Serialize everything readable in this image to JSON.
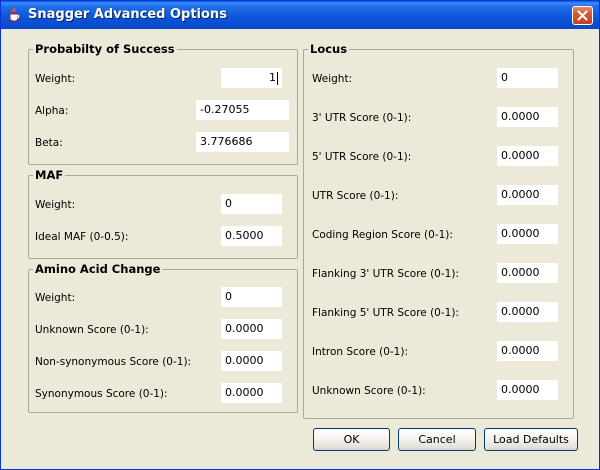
{
  "window": {
    "title": "Snagger Advanced Options"
  },
  "probability": {
    "legend": "Probabilty of Success",
    "weight_label": "Weight:",
    "weight_value": "1",
    "alpha_label": "Alpha:",
    "alpha_value": "-0.27055",
    "beta_label": "Beta:",
    "beta_value": "3.776686"
  },
  "maf": {
    "legend": "MAF",
    "weight_label": "Weight:",
    "weight_value": "0",
    "ideal_label": "Ideal MAF (0-0.5):",
    "ideal_value": "0.5000"
  },
  "amino": {
    "legend": "Amino Acid Change",
    "weight_label": "Weight:",
    "weight_value": "0",
    "unknown_label": "Unknown Score (0-1):",
    "unknown_value": "0.0000",
    "nonsyn_label": "Non-synonymous Score (0-1):",
    "nonsyn_value": "0.0000",
    "syn_label": "Synonymous Score (0-1):",
    "syn_value": "0.0000"
  },
  "locus": {
    "legend": "Locus",
    "weight_label": "Weight:",
    "weight_value": "0",
    "utr3_label": "3' UTR Score (0-1):",
    "utr3_value": "0.0000",
    "utr5_label": "5' UTR Score (0-1):",
    "utr5_value": "0.0000",
    "utr_label": "UTR Score (0-1):",
    "utr_value": "0.0000",
    "coding_label": "Coding Region Score (0-1):",
    "coding_value": "0.0000",
    "flank3_label": "Flanking 3' UTR Score (0-1):",
    "flank3_value": "0.0000",
    "flank5_label": "Flanking 5' UTR Score (0-1):",
    "flank5_value": "0.0000",
    "intron_label": "Intron Score (0-1):",
    "intron_value": "0.0000",
    "unknown_label": "Unknown Score (0-1):",
    "unknown_value": "0.0000"
  },
  "buttons": {
    "ok": "OK",
    "cancel": "Cancel",
    "load_defaults": "Load Defaults"
  },
  "icons": {
    "app": "java-cup-icon",
    "close": "close-icon"
  },
  "colors": {
    "titlebar": "#0a55d8",
    "background": "#ece9d8",
    "close": "#d45a35"
  }
}
